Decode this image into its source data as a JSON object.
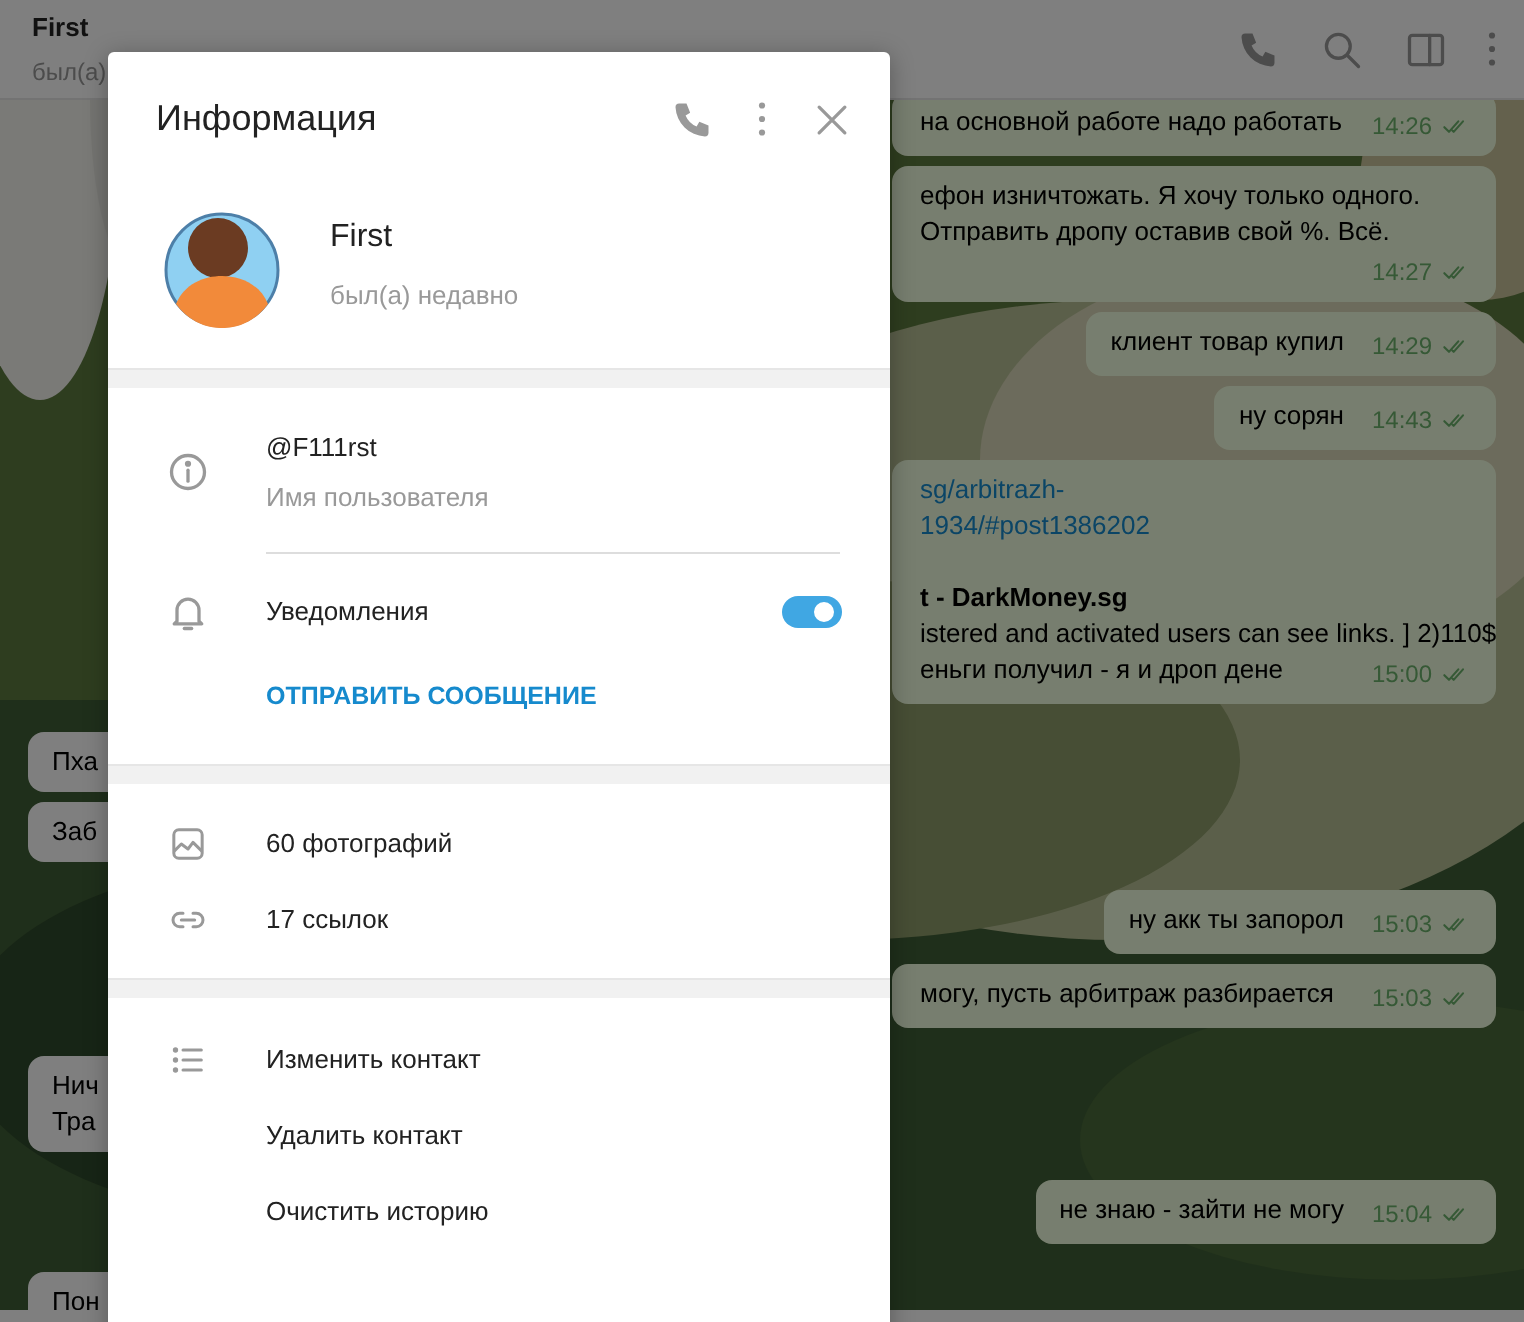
{
  "header": {
    "title": "First",
    "status": "был(а)"
  },
  "messages": [
    {
      "kind": "outgoing",
      "cut": true,
      "lines": [
        {
          "kind": "text",
          "text": "на основной работе надо работать"
        }
      ],
      "time": "14:26"
    },
    {
      "kind": "outgoing",
      "cut": true,
      "lines": [
        {
          "kind": "text",
          "text": "ефон изничтожать. Я хочу только одного."
        },
        {
          "kind": "text",
          "text": "Отправить дропу оставив свой %. Всё."
        }
      ],
      "time": "14:27"
    },
    {
      "kind": "outgoing",
      "cut": false,
      "lines": [
        {
          "kind": "text",
          "text": "клиент товар купил"
        }
      ],
      "time": "14:29"
    },
    {
      "kind": "outgoing",
      "cut": false,
      "lines": [
        {
          "kind": "text",
          "text": "ну сорян"
        }
      ],
      "time": "14:43"
    },
    {
      "kind": "outgoing",
      "cut": true,
      "lines": [
        {
          "kind": "link",
          "text": "sg/arbitrazh-"
        },
        {
          "kind": "link",
          "text": "1934/#post1386202"
        },
        {
          "kind": "title",
          "text": "t - DarkMoney.sg"
        },
        {
          "kind": "text",
          "text": "istered and activated users can see links. ] 2)110$"
        },
        {
          "kind": "text",
          "text": "еньги получил - я и дроп дене"
        }
      ],
      "time": "15:00"
    },
    {
      "kind": "incoming",
      "cut": true,
      "lines": [
        {
          "kind": "text",
          "text": "Пха"
        }
      ]
    },
    {
      "kind": "incoming",
      "cut": true,
      "lines": [
        {
          "kind": "text",
          "text": "Заб"
        }
      ]
    },
    {
      "kind": "outgoing",
      "cut": false,
      "lines": [
        {
          "kind": "text",
          "text": "ну акк ты запорол"
        }
      ],
      "time": "15:03"
    },
    {
      "kind": "outgoing",
      "cut": true,
      "lines": [
        {
          "kind": "text",
          "text": "могу, пусть арбитраж разбирается"
        }
      ],
      "time": "15:03"
    },
    {
      "kind": "incoming",
      "cut": true,
      "lines": [
        {
          "kind": "text",
          "text": "Нич"
        },
        {
          "kind": "text",
          "text": "Тра"
        }
      ]
    },
    {
      "kind": "outgoing",
      "cut": false,
      "lines": [
        {
          "kind": "text",
          "text": "не знаю - зайти не могу"
        }
      ],
      "time": "15:04"
    },
    {
      "kind": "incoming",
      "cut": true,
      "lines": [
        {
          "kind": "text",
          "text": "Пон"
        }
      ]
    }
  ],
  "dialog": {
    "title": "Информация",
    "profile": {
      "name": "First",
      "status": "был(а) недавно"
    },
    "username": {
      "value": "@F111rst",
      "label": "Имя пользователя"
    },
    "notifications": {
      "label": "Уведомления",
      "on": true
    },
    "send_message": "ОТПРАВИТЬ СООБЩЕНИЕ",
    "media": [
      {
        "kind": "photos",
        "label": "60 фотографий"
      },
      {
        "kind": "links",
        "label": "17 ссылок"
      }
    ],
    "actions": [
      {
        "label": "Изменить контакт"
      },
      {
        "label": "Удалить контакт"
      },
      {
        "label": "Очистить историю"
      }
    ]
  }
}
